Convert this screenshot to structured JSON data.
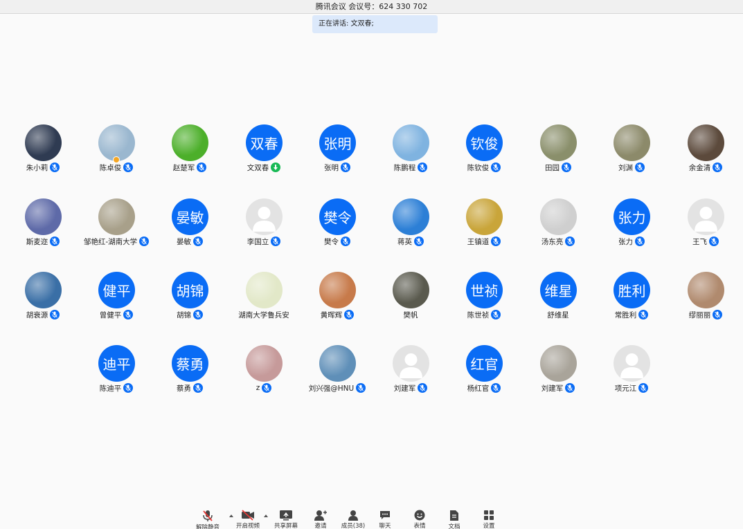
{
  "window": {
    "title": "腾讯会议 会议号：624 330 702"
  },
  "speaking": {
    "text": "正在讲话: 文双春;"
  },
  "participants": [
    {
      "name": "朱小莉",
      "avatar": "photo",
      "color": "#2f3b52",
      "mic": "on"
    },
    {
      "name": "陈卓俊",
      "avatar": "photo",
      "color": "#9ab7cf",
      "mic": "on",
      "host": true
    },
    {
      "name": "赵楚军",
      "avatar": "photo",
      "color": "#4caf2a",
      "mic": "on"
    },
    {
      "name": "文双春",
      "avatar": "text",
      "initials": "双春",
      "mic": "green"
    },
    {
      "name": "张明",
      "avatar": "text",
      "initials": "张明",
      "mic": "on"
    },
    {
      "name": "陈鹏程",
      "avatar": "photo",
      "color": "#7fb3e0",
      "mic": "on"
    },
    {
      "name": "陈钦俊",
      "avatar": "text",
      "initials": "钦俊",
      "mic": "on"
    },
    {
      "name": "田园",
      "avatar": "photo",
      "color": "#8a8f6b",
      "mic": "on"
    },
    {
      "name": "刘渊",
      "avatar": "photo",
      "color": "#8c8a6a",
      "mic": "on"
    },
    {
      "name": "余金清",
      "avatar": "photo",
      "color": "#5c4a3c",
      "mic": "on"
    },
    {
      "name": "斯麦迩",
      "avatar": "photo",
      "color": "#5e6aa8",
      "mic": "on"
    },
    {
      "name": "邹艳红-湖南大学",
      "avatar": "photo",
      "color": "#a8a08a",
      "mic": "on"
    },
    {
      "name": "晏敏",
      "avatar": "text",
      "initials": "晏敏",
      "mic": "on"
    },
    {
      "name": "李国立",
      "avatar": "default",
      "mic": "on"
    },
    {
      "name": "樊令",
      "avatar": "text",
      "initials": "樊令",
      "mic": "on"
    },
    {
      "name": "蒋英",
      "avatar": "photo",
      "color": "#2c7fd6",
      "mic": "on"
    },
    {
      "name": "王镇道",
      "avatar": "photo",
      "color": "#c9a53a",
      "mic": "on"
    },
    {
      "name": "汤东亮",
      "avatar": "photo",
      "color": "#cfcfcf",
      "mic": "on"
    },
    {
      "name": "张力",
      "avatar": "text",
      "initials": "张力",
      "mic": "on"
    },
    {
      "name": "王飞",
      "avatar": "default",
      "mic": "on"
    },
    {
      "name": "胡衰源",
      "avatar": "photo",
      "color": "#3a6fa6",
      "mic": "on"
    },
    {
      "name": "曾健平",
      "avatar": "text",
      "initials": "健平",
      "mic": "on"
    },
    {
      "name": "胡锦",
      "avatar": "text",
      "initials": "胡锦",
      "mic": "on"
    },
    {
      "name": "湖南大学鲁兵安",
      "avatar": "photo",
      "color": "#e2e8c8",
      "mic": "none"
    },
    {
      "name": "黄晖辉",
      "avatar": "photo",
      "color": "#c77a4a",
      "mic": "on"
    },
    {
      "name": "樊帆",
      "avatar": "photo",
      "color": "#5a5a4e",
      "mic": "none"
    },
    {
      "name": "陈世祯",
      "avatar": "text",
      "initials": "世祯",
      "mic": "on"
    },
    {
      "name": "舒维星",
      "avatar": "text",
      "initials": "维星",
      "mic": "none"
    },
    {
      "name": "常胜利",
      "avatar": "text",
      "initials": "胜利",
      "mic": "on"
    },
    {
      "name": "缪丽丽",
      "avatar": "photo",
      "color": "#b08a6e",
      "mic": "on"
    },
    {
      "name": "陈迪平",
      "avatar": "text",
      "initials": "迪平",
      "mic": "on"
    },
    {
      "name": "蔡勇",
      "avatar": "text",
      "initials": "蔡勇",
      "mic": "on"
    },
    {
      "name": "z",
      "avatar": "photo",
      "color": "#c69a9a",
      "mic": "on"
    },
    {
      "name": "刘兴强@HNU",
      "avatar": "photo",
      "color": "#5f8fb8",
      "mic": "on"
    },
    {
      "name": "刘建军",
      "avatar": "default",
      "mic": "on"
    },
    {
      "name": "杨红官",
      "avatar": "text",
      "initials": "红官",
      "mic": "on"
    },
    {
      "name": "刘建军",
      "avatar": "photo",
      "color": "#a9a49a",
      "mic": "on"
    },
    {
      "name": "项元江",
      "avatar": "default",
      "mic": "on"
    }
  ],
  "toolbar": {
    "unmute": "解除静音",
    "start_video": "开启视频",
    "share_screen": "共享屏幕",
    "invite": "邀请",
    "members": "成员(38)",
    "chat": "聊天",
    "reactions": "表情",
    "docs": "文档",
    "settings": "设置"
  }
}
